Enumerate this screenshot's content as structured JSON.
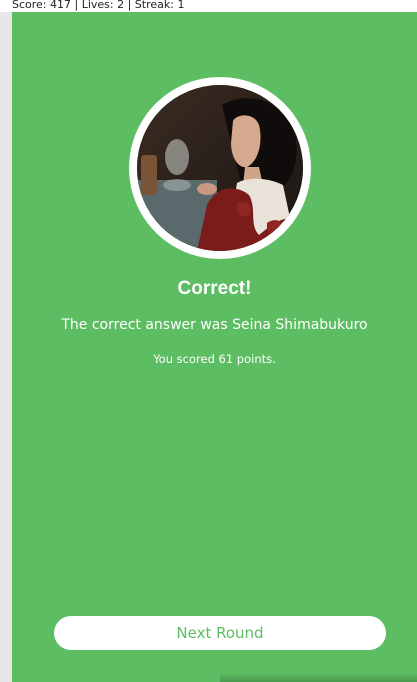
{
  "header": {
    "status_text": "Score: 417 | Lives: 2 | Streak: 1"
  },
  "result": {
    "title": "Correct!",
    "answer_text": "The correct answer was Seina Shimabukuro",
    "points_text": "You scored 61 points.",
    "next_button_label": "Next Round"
  },
  "colors": {
    "panel_background": "#5cbd62",
    "button_background": "#ffffff",
    "button_text": "#5cbd62",
    "text": "#ffffff"
  }
}
